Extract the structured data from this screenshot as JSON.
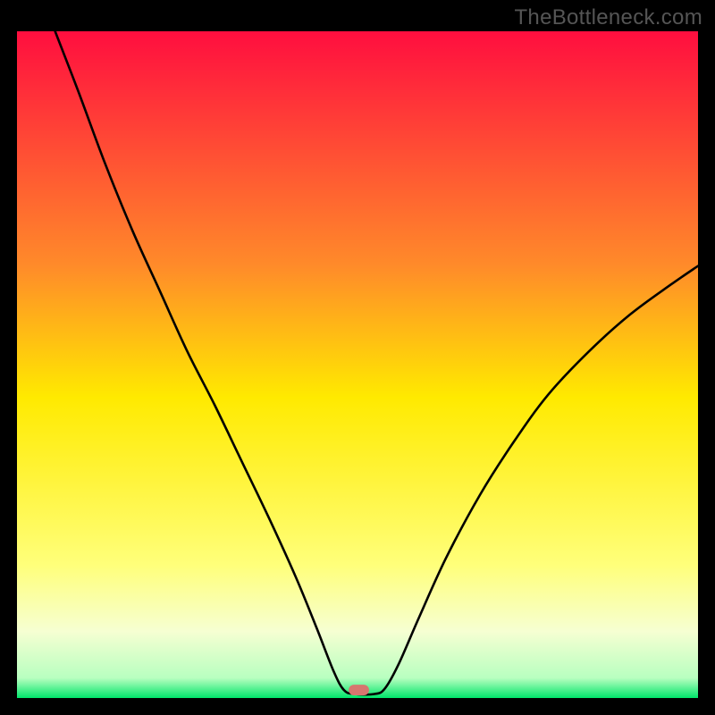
{
  "watermark": "TheBottleneck.com",
  "chart_data": {
    "type": "line",
    "title": "",
    "xlabel": "",
    "ylabel": "",
    "xlim": [
      0,
      100
    ],
    "ylim": [
      0,
      100
    ],
    "gradient_stops": [
      {
        "offset": 0.0,
        "color": "#ff0e3f"
      },
      {
        "offset": 0.35,
        "color": "#ff8a2a"
      },
      {
        "offset": 0.55,
        "color": "#ffea00"
      },
      {
        "offset": 0.8,
        "color": "#ffff7a"
      },
      {
        "offset": 0.9,
        "color": "#f6ffd2"
      },
      {
        "offset": 0.97,
        "color": "#b8ffc0"
      },
      {
        "offset": 1.0,
        "color": "#00e56a"
      }
    ],
    "curve": [
      {
        "x": 5.6,
        "y": 100.0
      },
      {
        "x": 9.0,
        "y": 91.0
      },
      {
        "x": 13.0,
        "y": 80.0
      },
      {
        "x": 17.0,
        "y": 70.0
      },
      {
        "x": 21.0,
        "y": 61.0
      },
      {
        "x": 25.0,
        "y": 52.0
      },
      {
        "x": 29.0,
        "y": 44.0
      },
      {
        "x": 33.0,
        "y": 35.5
      },
      {
        "x": 37.0,
        "y": 27.0
      },
      {
        "x": 41.0,
        "y": 18.0
      },
      {
        "x": 44.0,
        "y": 10.5
      },
      {
        "x": 46.5,
        "y": 4.0
      },
      {
        "x": 48.0,
        "y": 1.2
      },
      {
        "x": 49.5,
        "y": 0.6
      },
      {
        "x": 52.5,
        "y": 0.6
      },
      {
        "x": 54.0,
        "y": 1.4
      },
      {
        "x": 56.0,
        "y": 5.0
      },
      {
        "x": 59.0,
        "y": 12.0
      },
      {
        "x": 63.0,
        "y": 21.0
      },
      {
        "x": 68.0,
        "y": 30.5
      },
      {
        "x": 73.0,
        "y": 38.5
      },
      {
        "x": 78.0,
        "y": 45.5
      },
      {
        "x": 84.0,
        "y": 52.0
      },
      {
        "x": 90.0,
        "y": 57.5
      },
      {
        "x": 96.0,
        "y": 62.0
      },
      {
        "x": 100.0,
        "y": 64.8
      }
    ],
    "marker": {
      "x": 50.2,
      "y": 1.2,
      "w": 3.0,
      "h": 1.6,
      "color": "#d6766f"
    }
  }
}
